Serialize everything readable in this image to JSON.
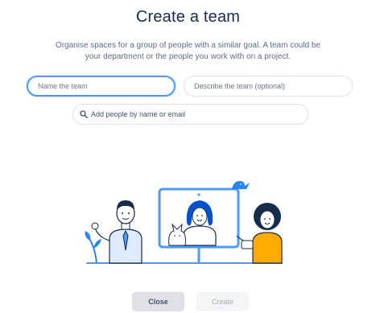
{
  "dialog": {
    "title": "Create a team",
    "subtitle_line1": "Organise spaces for a group of people with a similar goal. A team could be",
    "subtitle_line2": "your department or the people you work with on a project."
  },
  "form": {
    "name_placeholder": "Name the team",
    "description_placeholder": "Describe the team (optional)",
    "people_placeholder": "Add people by name or email"
  },
  "actions": {
    "close_label": "Close",
    "create_label": "Create"
  },
  "colors": {
    "accent": "#4c9aff",
    "primary_text": "#172b4d"
  }
}
